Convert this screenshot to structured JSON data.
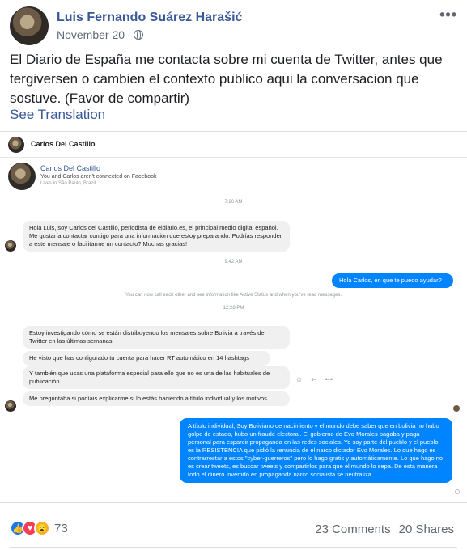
{
  "post": {
    "author": "Luis Fernando Suárez Harašić",
    "date": "November 20",
    "separator": "·",
    "more": "•••",
    "text": "El Diario de España me contacta sobre mi cuenta de Twitter, antes que tergiversen o cambien el contexto publico aqui la conversacion que sostuve. (Favor de compartir)",
    "see_translation": "See Translation"
  },
  "conversation": {
    "header_name": "Carlos Del Castillo",
    "contact_name": "Carlos Del Castillo",
    "not_connected": "You and Carlos aren't connected on Facebook",
    "lives_in": "Lives in São Paulo, Brazil",
    "time1": "7:26 AM",
    "msg1": "Hola Luis, soy Carlos del Castillo, periodista de eldiario.es, el principal medio digital español. Me gustaría contactar contigo para una información que estoy preparando. Podrías responder a este mensaje o facilitarme un contacto? Muchas gracias!",
    "time2": "9:42 AM",
    "reply1": "Hola Carlos, en que te puedo ayudar?",
    "notice": "You can now call each other and see information like Active Status and when you've read messages.",
    "time3": "12:28 PM",
    "msg2": "Estoy investigando cómo se están distribuyendo los mensajes sobre Bolivia a través de Twitter en las últimas semanas",
    "msg3": "He visto que has configurado tu cuenta para hacer RT automático en 14 hashtags",
    "msg4": "Y también que usas una plataforma especial para ello que no es una de las habituales de publicación",
    "msg5": "Me preguntaba si podíais explicarme si lo estás haciendo a título individual y los motivos",
    "reply2": "A título individual, Soy Boliviano de nacimiento y el mundo debe saber que en bolivia no hubo golpe de estado, hubo un fraude electoral. El gobierno de Evo Morales pagaba y paga personal para esparcir propaganda en las redes sociales. Yo soy parte del pueblo y el pueblo es la RESISTENCIA que pidió la renuncia de el narco dictador Evo Morales. Lo que hago es contrarrestar a estos \"cyber-guerreros\" pero lo hago gratis y automáticamente. Lo que hago no es crear tweets, es buscar tweets y compartirlos para que el mundo lo sepa. De esta manera todo el dinero invertido en propaganda narco socialista se neutraliza.",
    "actions": {
      "react": "☺",
      "reply": "↩",
      "more": "•••"
    }
  },
  "footer": {
    "reaction_icons": {
      "like": "👍",
      "love": "♥",
      "wow": "😮"
    },
    "reaction_count": "73",
    "comments": "23 Comments",
    "shares": "20 Shares"
  },
  "colors": {
    "link": "#385898",
    "messenger_blue": "#0084ff",
    "bubble_gray": "#f1f0f0"
  }
}
